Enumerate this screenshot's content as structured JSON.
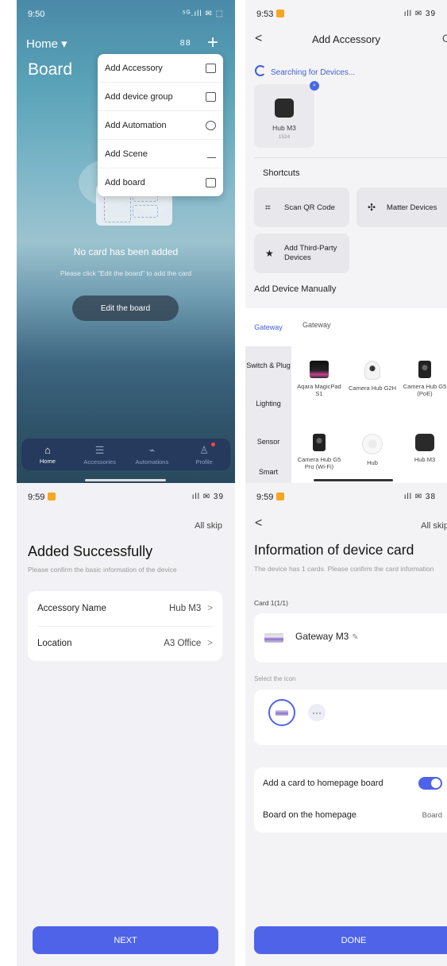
{
  "panel1": {
    "status_time": "9:50",
    "status_signal": "⁵ᴳ.ıll ✉ ⬚",
    "home_label": "Home ▾",
    "board_title": "Board",
    "grid_icon": "⁸⁸",
    "plus_icon": "+",
    "menu": [
      {
        "label": "Add Accessory",
        "icon": "≡"
      },
      {
        "label": "Add device group",
        "icon": "·"
      },
      {
        "label": "Add Automation",
        "icon": "◉"
      },
      {
        "label": "Add Scene",
        "icon": "⁄"
      },
      {
        "label": "Add board",
        "icon": "▯"
      }
    ],
    "no_card_text": "No card has been added",
    "hint_text": "Please click \"Edit the board\" to add the card",
    "edit_button": "Edit the board",
    "tabs": [
      {
        "label": "Home",
        "icon": "⌂",
        "active": true
      },
      {
        "label": "Accessories",
        "icon": "☰",
        "active": false
      },
      {
        "label": "Automations",
        "icon": "⌁",
        "active": false
      },
      {
        "label": "Profile",
        "icon": "♙",
        "active": false
      }
    ]
  },
  "panel2": {
    "status_time": "9:53",
    "status_signal": "ıll ✉ 39",
    "back": "<",
    "title": "Add Accessory",
    "refresh_icon": "C",
    "searching": "Searching for Devices...",
    "found_device": {
      "name": "Hub M3",
      "id": "1524"
    },
    "shortcuts_title": "Shortcuts",
    "shortcuts": [
      {
        "label": "Scan QR Code",
        "icon": "⌗"
      },
      {
        "label": "Matter Devices",
        "icon": "✣"
      },
      {
        "label": "Add Third-Party Devices",
        "icon": "★"
      }
    ],
    "manual_title": "Add Device Manually",
    "categories": [
      "Gateway",
      "Switch & Plug",
      "Lighting",
      "Sensor",
      "Smart"
    ],
    "subcategory": "Gateway",
    "devices": [
      {
        "name": "Aqara MagicPad S1"
      },
      {
        "name": "Camera Hub G2H"
      },
      {
        "name": "Camera Hub G5 (PoE)"
      },
      {
        "name": "Camera Hub G5 Pro (Wi-Fi)"
      },
      {
        "name": "Hub"
      },
      {
        "name": "Hub M3"
      }
    ]
  },
  "panel3": {
    "status_time": "9:59",
    "status_signal": "ıll ✉ 39",
    "skip": "All skip",
    "title": "Added Successfully",
    "subtitle": "Please confirm the basic information of the device",
    "rows": [
      {
        "label": "Accessory Name",
        "value": "Hub M3"
      },
      {
        "label": "Location",
        "value": "A3 Office"
      }
    ],
    "chevron": ">",
    "next_button": "NEXT"
  },
  "panel4": {
    "status_time": "9:59",
    "status_signal": "ıll ✉ 38",
    "back": "<",
    "skip": "All skip",
    "title": "Information of device card",
    "subtitle": "The device has 1 cards. Please confirm the card information",
    "card_label": "Card 1(1/1)",
    "card_name": "Gateway M3",
    "pencil_icon": "✎",
    "icon_label": "Select the icon",
    "more_icon": "···",
    "add_to_board_label": "Add a card to homepage board",
    "board_label": "Board on the homepage",
    "board_value": "Board",
    "done_button": "DONE"
  }
}
